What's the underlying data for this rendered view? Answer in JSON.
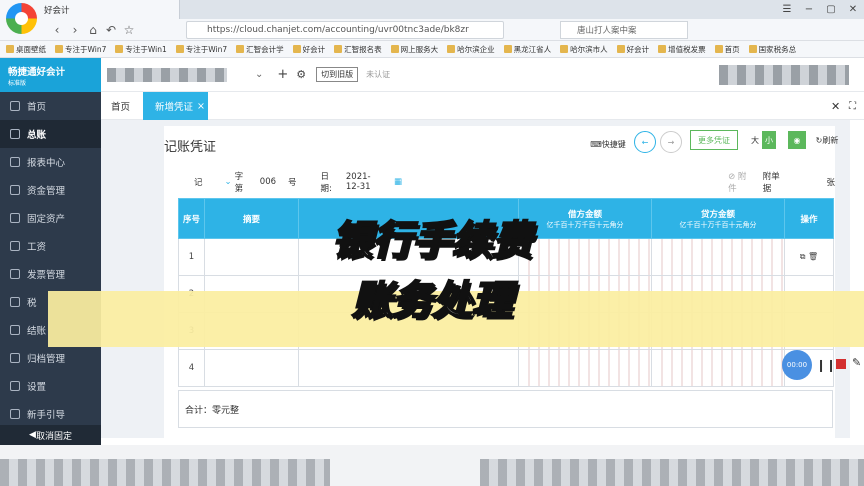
{
  "browser": {
    "tab_title": "好会计",
    "url": "https://cloud.chanjet.com/accounting/uvr00tnc3ade/bk8zr",
    "search_text": "唐山打人案中案",
    "bookmarks": [
      "桌面壁纸",
      "专注于Win7",
      "专注于Win1",
      "专注于Win7",
      "汇智会计学",
      "好会计",
      "汇智报名表",
      "网上服务大",
      "哈尔滨企业",
      "黑龙江省人",
      "哈尔滨市人",
      "好会计",
      "增值税发票",
      "首页",
      "国家税务总"
    ]
  },
  "app": {
    "brand": "畅捷通好会计",
    "brand_sub": "标准版",
    "switch_btn": "切到旧版",
    "cert_label": "未认证"
  },
  "sidebar": {
    "items": [
      {
        "label": "首页",
        "icon": "home-icon"
      },
      {
        "label": "总账",
        "icon": "ledger-icon",
        "active": true
      },
      {
        "label": "报表中心",
        "icon": "report-icon"
      },
      {
        "label": "资金管理",
        "icon": "money-icon"
      },
      {
        "label": "固定资产",
        "icon": "asset-icon"
      },
      {
        "label": "工资",
        "icon": "salary-icon"
      },
      {
        "label": "发票管理",
        "icon": "invoice-icon"
      },
      {
        "label": "税",
        "icon": "tax-icon"
      },
      {
        "label": "结账",
        "icon": "close-book-icon"
      },
      {
        "label": "归档管理",
        "icon": "archive-icon"
      },
      {
        "label": "设置",
        "icon": "settings-icon"
      },
      {
        "label": "新手引导",
        "icon": "guide-icon"
      }
    ],
    "unpin": "取消固定"
  },
  "tabs": {
    "home": "首页",
    "active": "新增凭证",
    "close": "×"
  },
  "voucher": {
    "title": "记账凭证",
    "shortcut": "快捷键",
    "more": "更多凭证",
    "size_large": "大",
    "size_small": "小",
    "refresh": "刷新",
    "word": "记",
    "word_type": "字第",
    "number": "006",
    "number_suffix": "号",
    "date_label": "日期:",
    "date": "2021-12-31",
    "attach": "附件",
    "attach_count_label": "附单据",
    "attach_unit": "张",
    "headers": {
      "seq": "序号",
      "summary": "摘要",
      "debit": "借方金额",
      "credit": "贷方金额",
      "ops": "操作",
      "digits": "亿千百十万千百十元角分"
    },
    "rows": [
      "1",
      "2",
      "3",
      "4"
    ],
    "total": "合计：零元整"
  },
  "overlay": {
    "line1": "银行手续费",
    "line2": "账务处理"
  },
  "recorder": {
    "time": "00:00"
  }
}
